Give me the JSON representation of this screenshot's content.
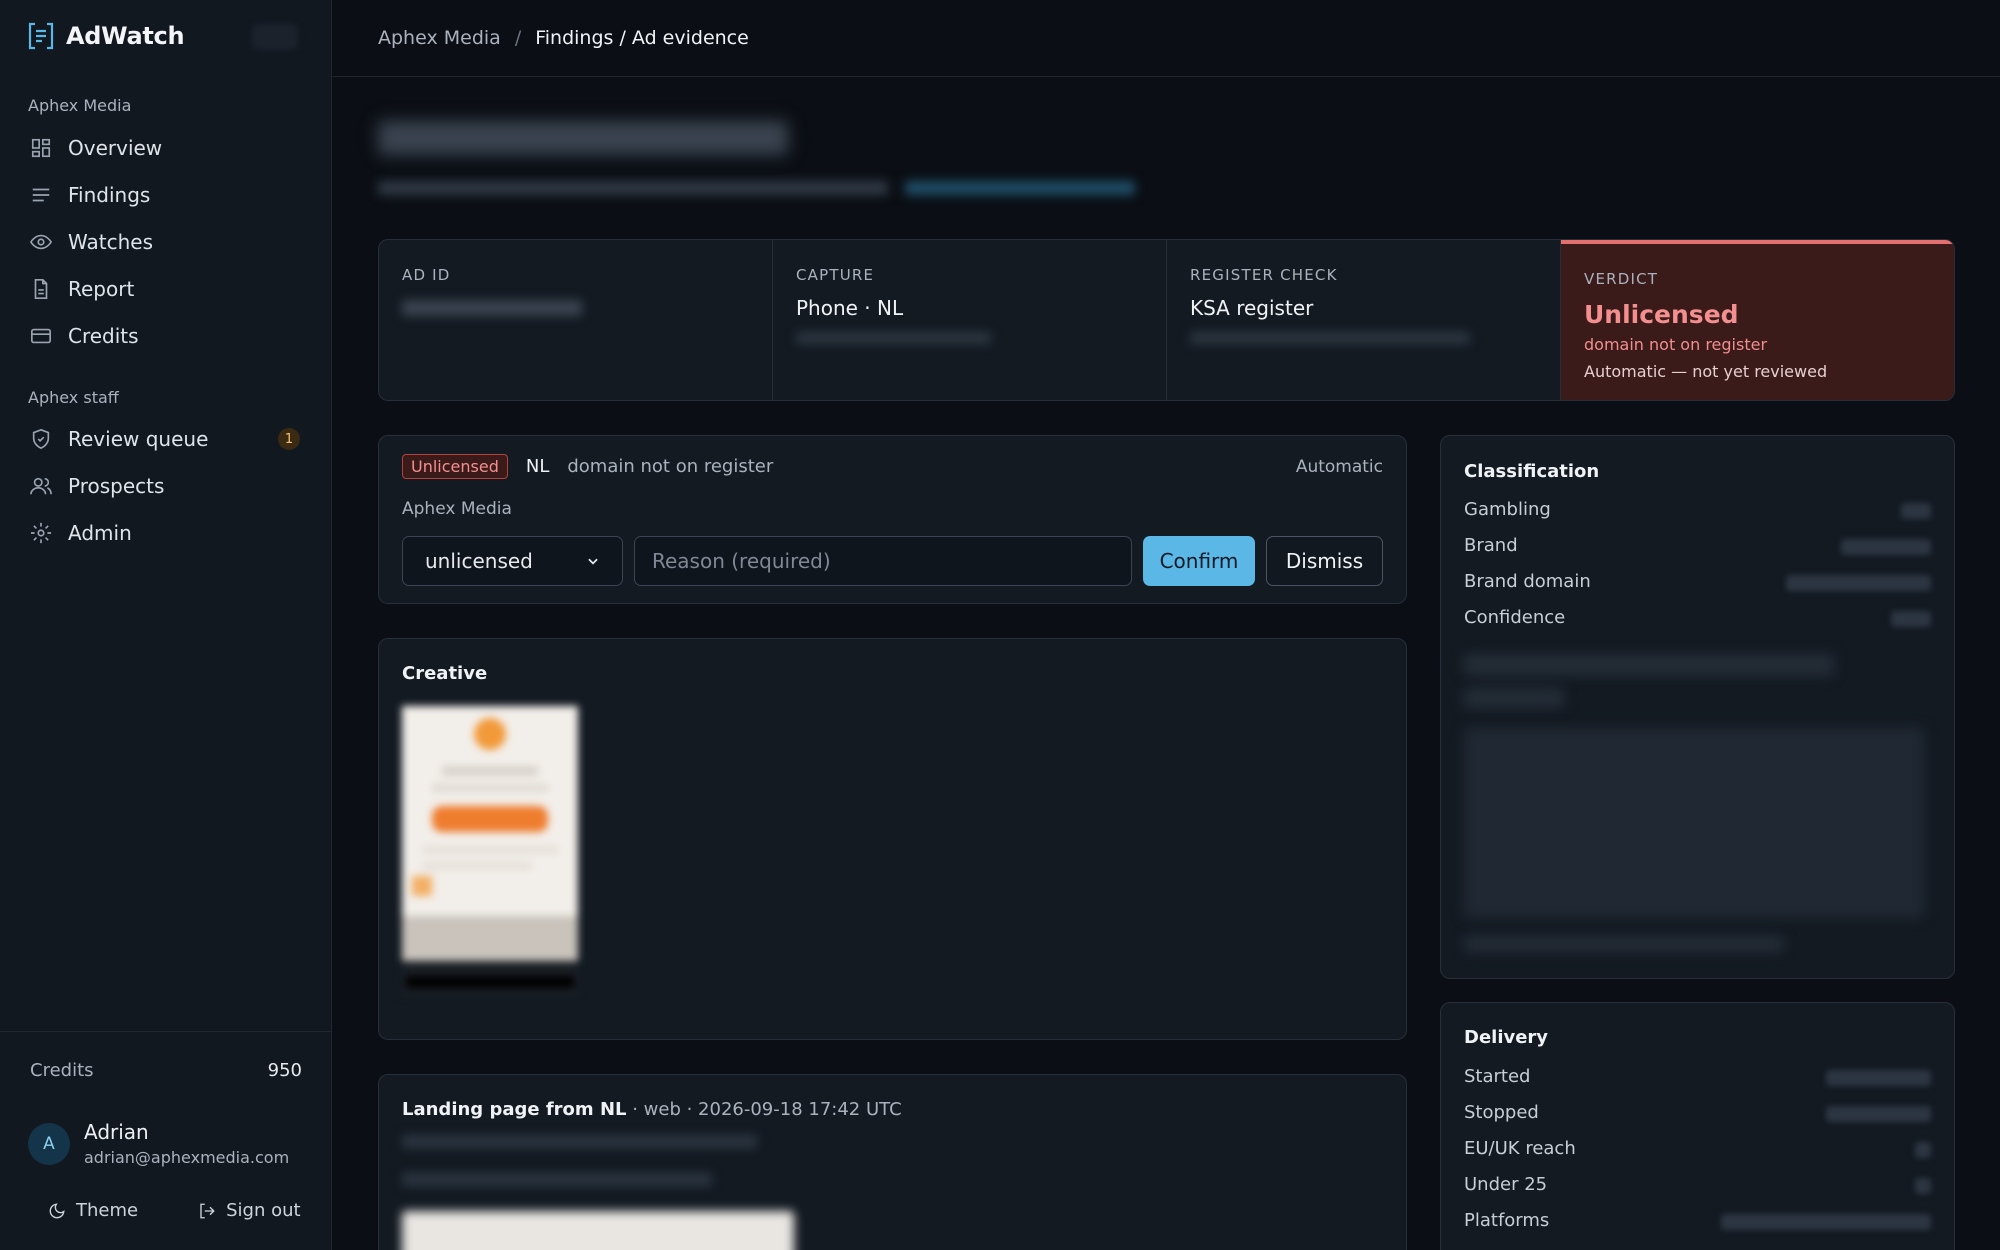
{
  "app": {
    "name": "AdWatch"
  },
  "sidebar": {
    "org_section": "Aphex Media",
    "items": [
      {
        "label": "Overview",
        "icon": "overview-icon"
      },
      {
        "label": "Findings",
        "icon": "findings-icon"
      },
      {
        "label": "Watches",
        "icon": "eye-icon"
      },
      {
        "label": "Report",
        "icon": "report-icon"
      },
      {
        "label": "Credits",
        "icon": "credits-icon"
      }
    ],
    "staff_section": "Aphex staff",
    "staff_items": [
      {
        "label": "Review queue",
        "icon": "shield-check-icon",
        "badge": "1"
      },
      {
        "label": "Prospects",
        "icon": "users-icon"
      },
      {
        "label": "Admin",
        "icon": "gear-icon"
      }
    ],
    "credits_label": "Credits",
    "credits_value": "950",
    "user": {
      "initial": "A",
      "name": "Adrian",
      "email": "adrian@aphexmedia.com"
    },
    "theme_label": "Theme",
    "signout_label": "Sign out"
  },
  "breadcrumb": {
    "org": "Aphex Media",
    "sep": "/",
    "current": "Findings / Ad evidence"
  },
  "summary": {
    "ad_id_label": "AD ID",
    "capture_label": "CAPTURE",
    "capture_value": "Phone · NL",
    "register_label": "REGISTER CHECK",
    "register_value": "KSA register",
    "verdict_label": "VERDICT",
    "verdict_value": "Unlicensed",
    "verdict_reason": "domain not on register",
    "verdict_status": "Automatic — not yet reviewed"
  },
  "finding": {
    "tag": "Unlicensed",
    "country": "NL",
    "reason": "domain not on register",
    "mode": "Automatic",
    "org": "Aphex Media",
    "select_value": "unlicensed",
    "reason_placeholder": "Reason (required)",
    "confirm_label": "Confirm",
    "dismiss_label": "Dismiss"
  },
  "creative": {
    "title": "Creative"
  },
  "landing": {
    "title": "Landing page from NL",
    "meta": " · web · 2026-09-18 17:42 UTC"
  },
  "classification": {
    "title": "Classification",
    "rows": [
      "Gambling",
      "Brand",
      "Brand domain",
      "Confidence"
    ]
  },
  "delivery": {
    "title": "Delivery",
    "rows": [
      "Started",
      "Stopped",
      "EU/UK reach",
      "Under 25",
      "Platforms"
    ]
  },
  "colors": {
    "accent": "#5ab7e6",
    "danger": "#f48f8f",
    "danger_bg": "#3b1a1a"
  }
}
